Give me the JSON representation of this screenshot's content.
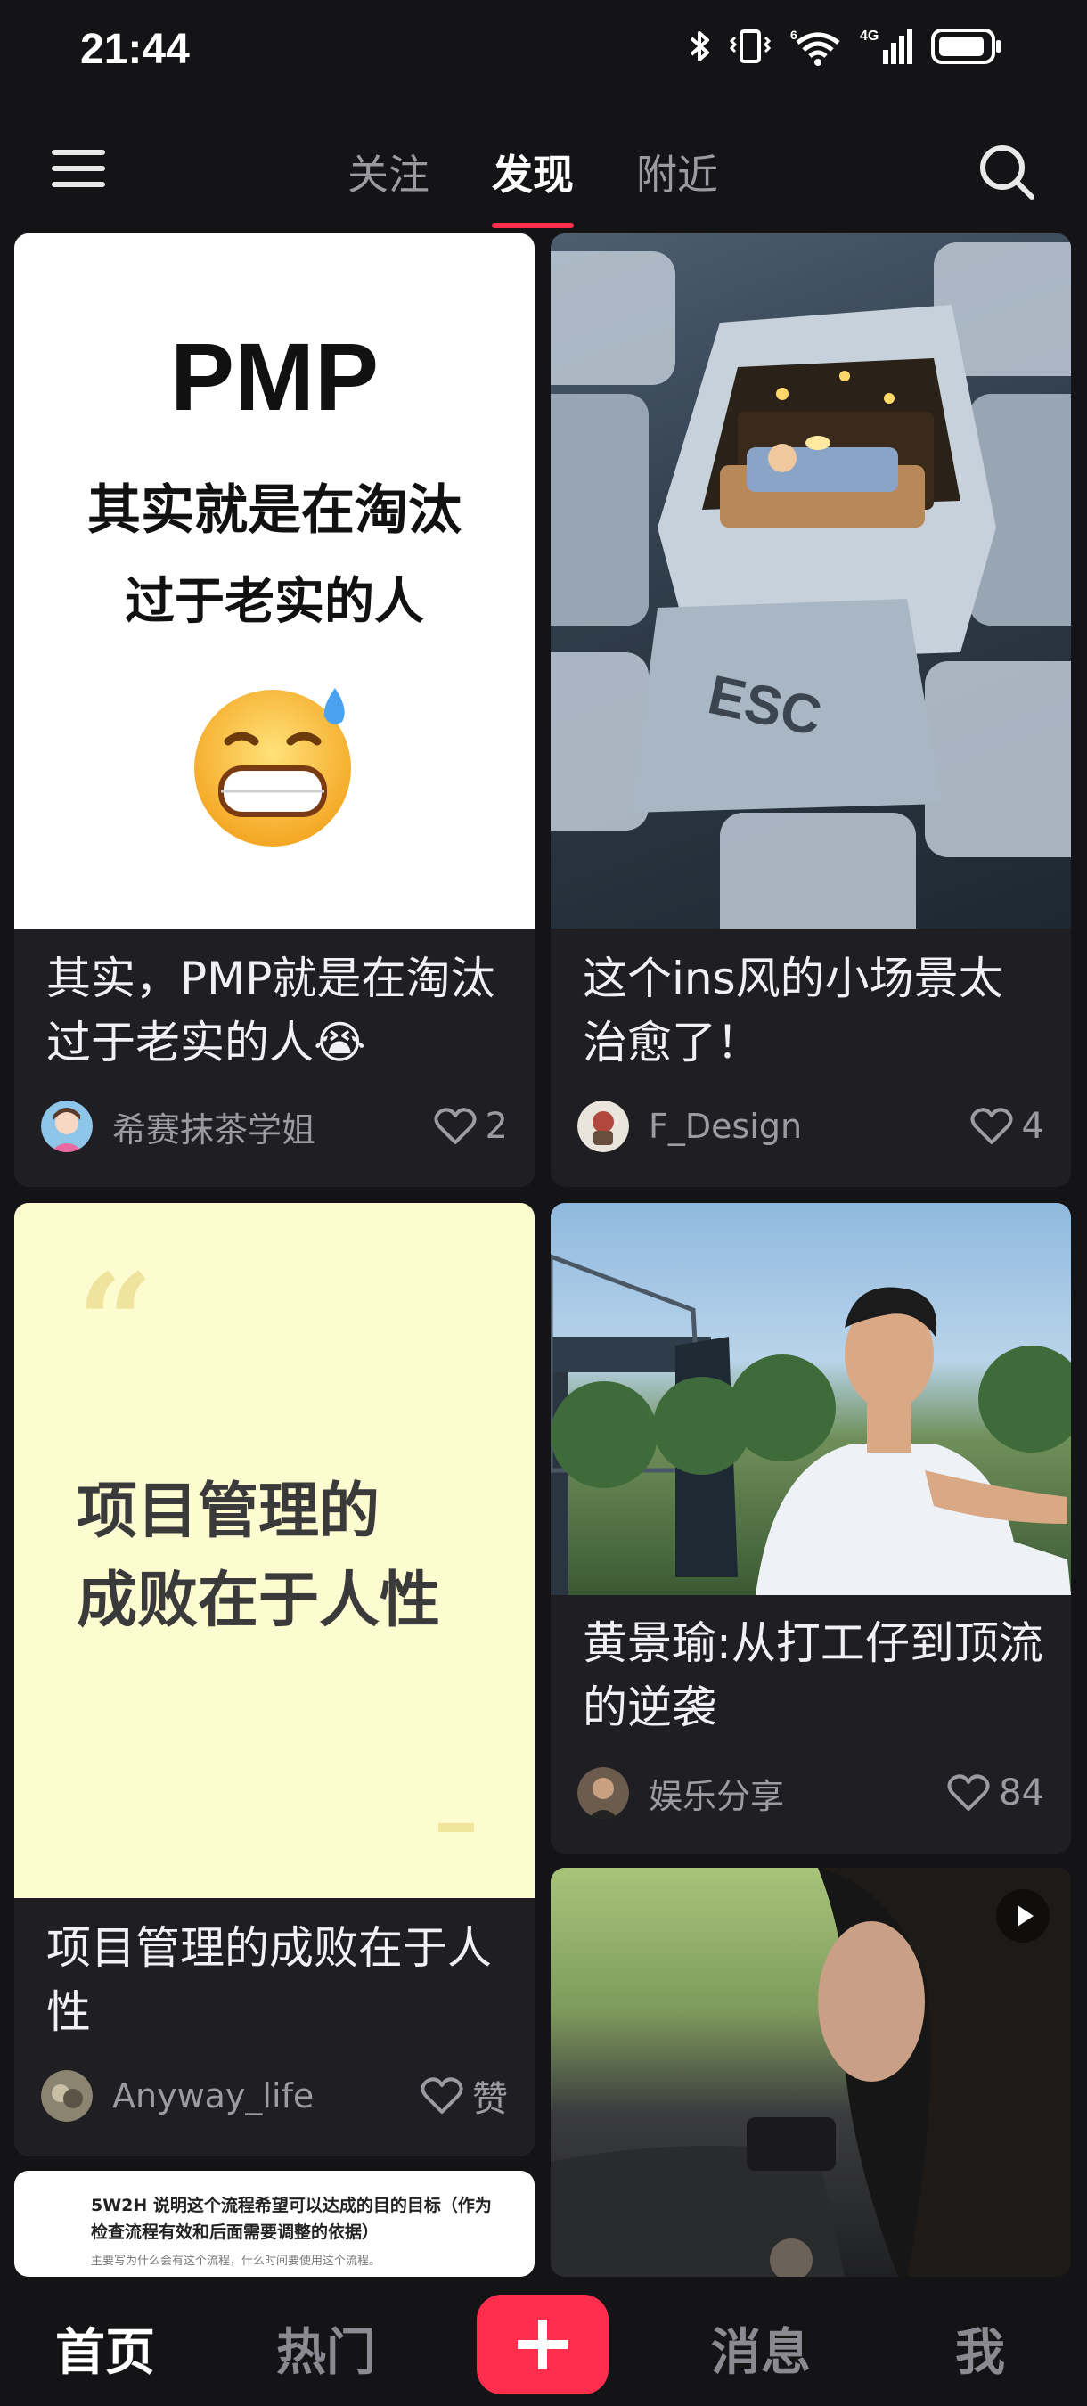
{
  "status_bar": {
    "time": "21:44",
    "network": "4G",
    "signal_superscript": "6"
  },
  "top_nav": {
    "tabs": [
      {
        "label": "关注",
        "active": false
      },
      {
        "label": "发现",
        "active": true
      },
      {
        "label": "附近",
        "active": false
      }
    ],
    "menu_icon": "hamburger-icon",
    "search_icon": "search-icon"
  },
  "feed": [
    {
      "cover_lines": [
        "PMP",
        "其实就是在淘汰",
        "过于老实的人"
      ],
      "title": "其实，PMP就是在淘汰过于老实的人😭",
      "author": "希赛抹茶学姐",
      "likes": "2"
    },
    {
      "cover_text": "ESC",
      "title": "这个ins风的小场景太治愈了！",
      "author": "F_Design",
      "likes": "4"
    },
    {
      "cover_lines": [
        "项目管理的",
        "成败在于人性"
      ],
      "title": "项目管理的成败在于人性",
      "author": "Anyway_life",
      "likes": "赞"
    },
    {
      "title": "黄景瑜:从打工仔到顶流的逆袭",
      "author": "娱乐分享",
      "likes": "84"
    },
    {
      "cover_lines": [
        "5W2H 说明这个流程希望可以达成的目的目标（作为",
        "检查流程有效和后面需要调整的依据）",
        "主要写为什么会有这个流程，什么时间要使用这个流程。"
      ]
    },
    {
      "is_video": true
    }
  ],
  "bottom_nav": {
    "items": [
      {
        "label": "首页",
        "active": true
      },
      {
        "label": "热门",
        "active": false
      },
      {
        "label": "消息",
        "active": false
      },
      {
        "label": "我",
        "active": false
      }
    ],
    "publish_icon": "plus-icon"
  },
  "colors": {
    "accent": "#ff2e4d",
    "background": "#141417",
    "card": "#1f1f23"
  }
}
